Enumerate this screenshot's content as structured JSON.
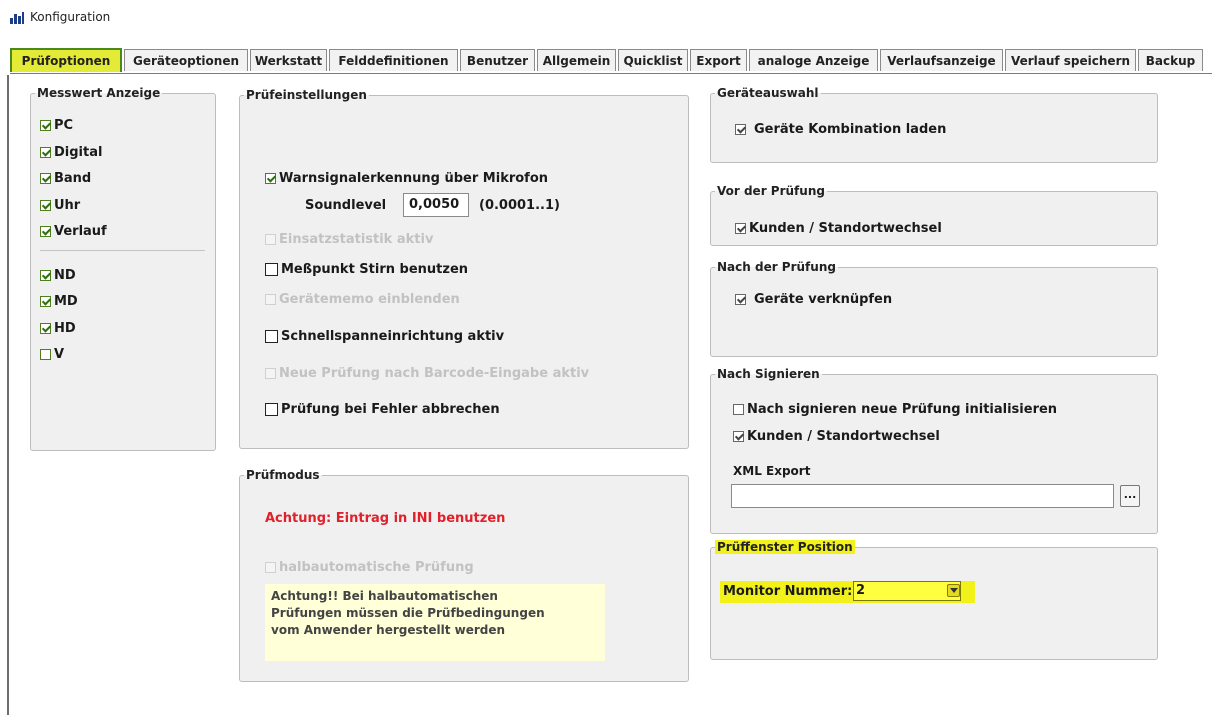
{
  "window": {
    "title": "Konfiguration",
    "icon": "app-window-icon"
  },
  "tabs": [
    {
      "label": "Prüfoptionen",
      "active": true
    },
    {
      "label": "Geräteoptionen"
    },
    {
      "label": "Werkstatt"
    },
    {
      "label": "Felddefinitionen"
    },
    {
      "label": "Benutzer"
    },
    {
      "label": "Allgemein"
    },
    {
      "label": "Quicklist"
    },
    {
      "label": "Export"
    },
    {
      "label": "analoge Anzeige"
    },
    {
      "label": "Verlaufsanzeige"
    },
    {
      "label": "Verlauf speichern"
    },
    {
      "label": "Backup"
    }
  ],
  "messwert": {
    "legend": "Messwert Anzeige",
    "items": [
      {
        "label": "PC",
        "checked": true
      },
      {
        "label": "Digital",
        "checked": true
      },
      {
        "label": "Band",
        "checked": true
      },
      {
        "label": "Uhr",
        "checked": true
      },
      {
        "label": "Verlauf",
        "checked": true
      }
    ],
    "items2": [
      {
        "label": "ND",
        "checked": true
      },
      {
        "label": "MD",
        "checked": true
      },
      {
        "label": "HD",
        "checked": true
      },
      {
        "label": "V",
        "checked": false
      }
    ]
  },
  "pruefeinstellungen": {
    "legend": "Prüfeinstellungen",
    "warnsignal_label": "Warnsignalerkennung über Mikrofon",
    "warnsignal_checked": true,
    "soundlevel_label": "Soundlevel",
    "soundlevel_value": "0,0050",
    "soundlevel_range": "(0.0001..1)",
    "einsatzstatistik_label": "Einsatzstatistik aktiv",
    "messpunkt_label": "Meßpunkt Stirn benutzen",
    "geraetememo_label": "Gerätememo einblenden",
    "schnellspann_label": "Schnellspanneinrichtung aktiv",
    "neue_pruefung_label": "Neue Prüfung nach Barcode-Eingabe aktiv",
    "abbrechen_label": "Prüfung bei Fehler abbrechen"
  },
  "pruefmodus": {
    "legend": "Prüfmodus",
    "warning": "Achtung: Eintrag in INI benutzen",
    "halbauto_label": "halbautomatische Prüfung",
    "note_lines": [
      "Achtung!! Bei halbautomatischen",
      "Prüfungen müssen die Prüfbedingungen",
      "vom Anwender hergestellt werden"
    ]
  },
  "geraeteauswahl": {
    "legend": "Geräteauswahl",
    "label": "Geräte Kombination laden",
    "checked": true
  },
  "vor_pruefung": {
    "legend": "Vor der Prüfung",
    "label": "Kunden / Standortwechsel",
    "checked": true
  },
  "nach_pruefung": {
    "legend": "Nach der Prüfung",
    "label": "Geräte verknüpfen",
    "checked": true
  },
  "nach_signieren": {
    "legend": "Nach Signieren",
    "init_label": "Nach signieren neue Prüfung initialisieren",
    "init_checked": false,
    "kunden_label": "Kunden / Standortwechsel",
    "kunden_checked": true,
    "xml_label": "XML Export",
    "xml_value": "",
    "browse_label": "..."
  },
  "prueffenster": {
    "legend": "Prüffenster Position",
    "monitor_label": "Monitor Nummer:",
    "monitor_value": "2"
  }
}
